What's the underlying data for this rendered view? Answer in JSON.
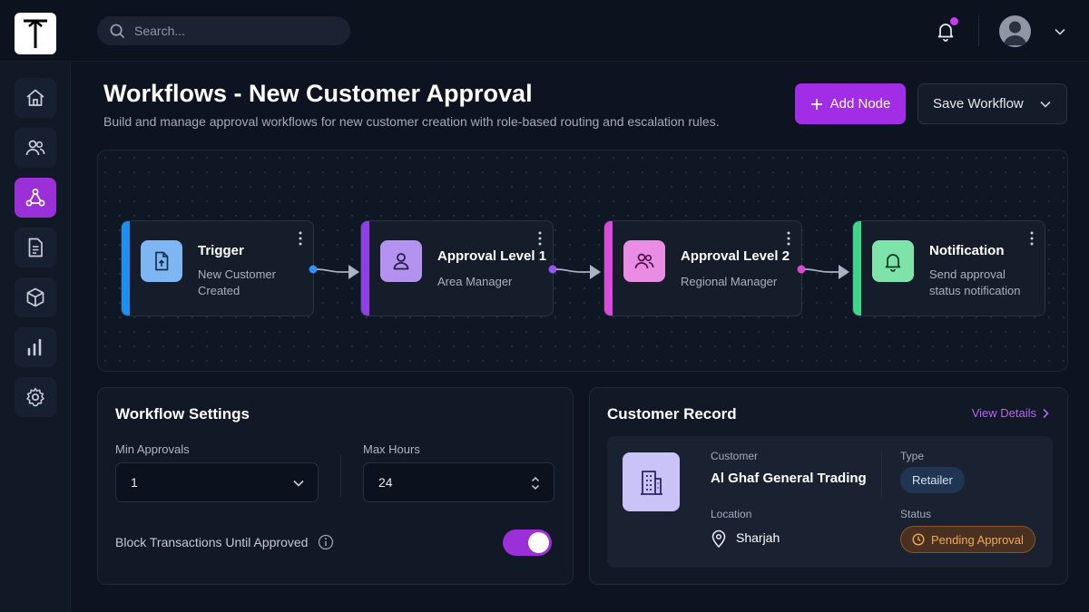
{
  "header": {
    "search_placeholder": "Search..."
  },
  "page": {
    "title": "Workflows - New Customer Approval",
    "subtitle": "Build and manage approval workflows for new customer creation with role-based routing and escalation rules.",
    "add_node_label": "Add Node",
    "save_workflow_label": "Save Workflow"
  },
  "sidebar": {
    "items": [
      {
        "icon": "home-icon"
      },
      {
        "icon": "users-icon"
      },
      {
        "icon": "workflow-icon",
        "active": true
      },
      {
        "icon": "document-icon"
      },
      {
        "icon": "box-icon"
      },
      {
        "icon": "bar-chart-icon"
      },
      {
        "icon": "gear-icon"
      }
    ]
  },
  "workflow": {
    "nodes": [
      {
        "title": "Trigger",
        "line1": "New Customer",
        "line2": "Created",
        "accent": "#1e8ff0",
        "icon": "file-upload-icon"
      },
      {
        "title": "Approval Level 1",
        "line1": "Area Manager",
        "line2": "",
        "accent": "#8e3fe6",
        "icon": "user-icon"
      },
      {
        "title": "Approval Level 2",
        "line1": "Regional Manager",
        "line2": "",
        "accent": "#d94bd9",
        "icon": "users-icon"
      },
      {
        "title": "Notification",
        "line1": "Send approval",
        "line2": "status notification",
        "accent": "#3ed68a",
        "icon": "bell-icon"
      }
    ]
  },
  "settings": {
    "title": "Workflow Settings",
    "min_approvals_label": "Min Approvals",
    "min_approvals_value": "1",
    "max_hours_label": "Max Hours",
    "max_hours_value": "24",
    "block_label": "Block Transactions Until Approved",
    "block_enabled": true
  },
  "record": {
    "title": "Customer Record",
    "view_details_label": "View Details",
    "customer_label": "Customer",
    "customer_value": "Al Ghaf General Trading",
    "type_label": "Type",
    "type_value": "Retailer",
    "location_label": "Location",
    "location_value": "Sharjah",
    "status_label": "Status",
    "status_value": "Pending Approval"
  },
  "colors": {
    "accent_purple": "#a12ee6",
    "status_pending": "#f2ab55"
  }
}
